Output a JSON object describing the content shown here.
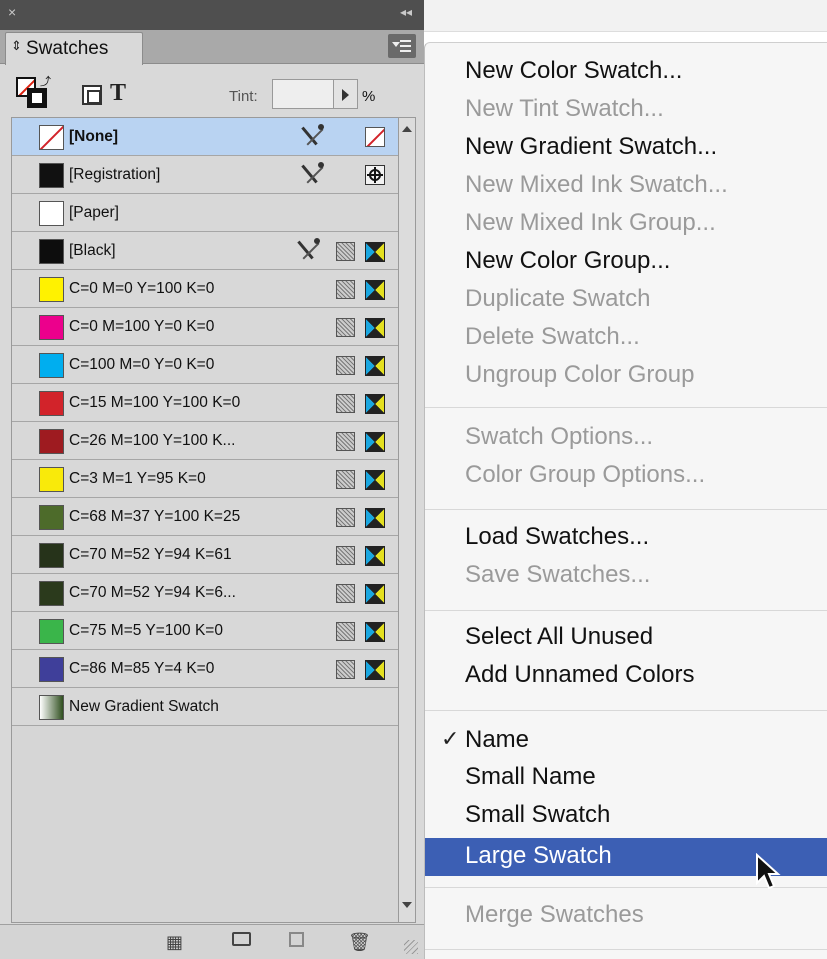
{
  "panel": {
    "close_glyph": "×",
    "collapse_glyph": "◂◂",
    "tab_label": "Swatches",
    "tint_label": "Tint:",
    "tint_value": "",
    "percent_label": "%",
    "swatches": [
      {
        "name": "[None]",
        "selected": true
      },
      {
        "name": "[Registration]",
        "color": "#111111"
      },
      {
        "name": "[Paper]",
        "color": "#ffffff"
      },
      {
        "name": "[Black]",
        "color": "#0d0d0d"
      },
      {
        "name": "C=0 M=0 Y=100 K=0",
        "color": "#fff200"
      },
      {
        "name": "C=0 M=100 Y=0 K=0",
        "color": "#ec008c"
      },
      {
        "name": "C=100 M=0 Y=0 K=0",
        "color": "#00aeef"
      },
      {
        "name": "C=15 M=100 Y=100 K=0",
        "color": "#d2232a"
      },
      {
        "name": "C=26 M=100 Y=100 K...",
        "color": "#9e1b20"
      },
      {
        "name": "C=3 M=1 Y=95 K=0",
        "color": "#f9ea0a"
      },
      {
        "name": "C=68 M=37 Y=100 K=25",
        "color": "#4d6b2a"
      },
      {
        "name": "C=70 M=52 Y=94 K=61",
        "color": "#26331a"
      },
      {
        "name": "C=70 M=52 Y=94 K=6...",
        "color": "#2b3a1c"
      },
      {
        "name": "C=75 M=5 Y=100 K=0",
        "color": "#3ab54a"
      },
      {
        "name": "C=86 M=85 Y=4 K=0",
        "color": "#3f3f9a"
      },
      {
        "name": "New Gradient Swatch",
        "color": "gradient"
      }
    ]
  },
  "menu": {
    "items": [
      {
        "label": "New Color Swatch...",
        "enabled": true
      },
      {
        "label": "New Tint Swatch...",
        "enabled": false
      },
      {
        "label": "New Gradient Swatch...",
        "enabled": true
      },
      {
        "label": "New Mixed Ink Swatch...",
        "enabled": false
      },
      {
        "label": "New Mixed Ink Group...",
        "enabled": false
      },
      {
        "label": "New Color Group...",
        "enabled": true
      },
      {
        "label": "Duplicate Swatch",
        "enabled": false
      },
      {
        "label": "Delete Swatch...",
        "enabled": false
      },
      {
        "label": "Ungroup Color Group",
        "enabled": false
      },
      {
        "label": "Swatch Options...",
        "enabled": false
      },
      {
        "label": "Color Group Options...",
        "enabled": false
      },
      {
        "label": "Load Swatches...",
        "enabled": true
      },
      {
        "label": "Save Swatches...",
        "enabled": false
      },
      {
        "label": "Select All Unused",
        "enabled": true
      },
      {
        "label": "Add Unnamed Colors",
        "enabled": true
      },
      {
        "label": "Name",
        "enabled": true,
        "checked": true
      },
      {
        "label": "Small Name",
        "enabled": true
      },
      {
        "label": "Small Swatch",
        "enabled": true
      },
      {
        "label": "Large Swatch",
        "enabled": true,
        "highlighted": true
      },
      {
        "label": "Merge Swatches",
        "enabled": false
      }
    ],
    "check_glyph": "✓",
    "highlight_color": "#3c5fb4"
  }
}
